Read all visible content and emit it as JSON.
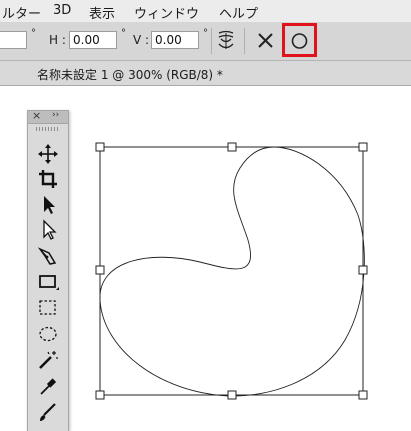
{
  "menu": {
    "items": [
      "ルター",
      "3D",
      "表示",
      "ウィンドウ",
      "ヘルプ"
    ]
  },
  "options_bar": {
    "w_unit": "°",
    "h_label": "H :",
    "h_value": "0.00",
    "h_unit": "°",
    "v_label": "V :",
    "v_value": "0.00",
    "v_unit": "°",
    "icons": [
      "warp-mode-icon",
      "cancel-transform-icon",
      "commit-transform-icon"
    ],
    "commit_highlight_color": "#e0121b"
  },
  "document_tab": {
    "title": "名称未設定 1 @ 300% (RGB/8) *"
  },
  "tools_panel": {
    "header_close": "×",
    "header_collapse": "››",
    "tools": [
      "move-tool",
      "crop-tool",
      "path-selection-tool",
      "direct-selection-tool",
      "pen-tool",
      "rectangle-tool",
      "rectangular-marquee-tool",
      "elliptical-marquee-tool",
      "magic-wand-tool",
      "eyedropper-tool",
      "brush-tool"
    ]
  },
  "canvas": {
    "background": "#ffffff",
    "shape": "curved-path-in-transform-box"
  }
}
